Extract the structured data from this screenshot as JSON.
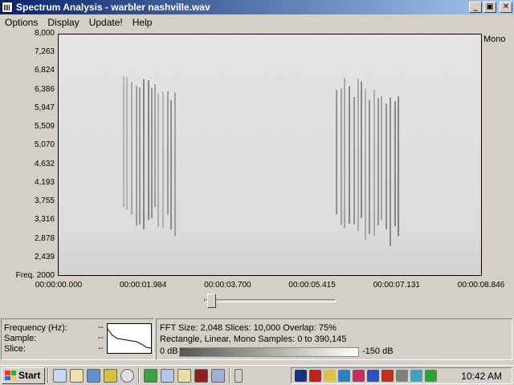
{
  "window": {
    "title": "Spectrum Analysis - warbler nashville.wav"
  },
  "title_buttons": {
    "minimize": "_",
    "maximize": "▣",
    "close": "✕"
  },
  "menu": [
    "Options",
    "Display",
    "Update!",
    "Help"
  ],
  "chart_data": {
    "type": "heatmap",
    "title": "",
    "channel_label": "Mono",
    "y_axis": {
      "label": "Freq.",
      "ticks": [
        "8,000",
        "7,263",
        "6,824",
        "6,386",
        "5,947",
        "5,509",
        "5,070",
        "4,632",
        "4,193",
        "3,755",
        "3,316",
        "2,878",
        "2,439",
        "2000"
      ],
      "ylim": [
        2000,
        8000
      ]
    },
    "x_axis": {
      "ticks": [
        "00:00:00.000",
        "00:00:01.984",
        "00:00:03.700",
        "00:00:05.415",
        "00:00:07.131",
        "00:00:08.846"
      ],
      "xlim_seconds": [
        0,
        8.846
      ]
    },
    "colorscale": {
      "min_label": "0 dB",
      "max_label": "-150 dB"
    }
  },
  "info": {
    "labels": [
      "Frequency (Hz):",
      "Sample:",
      "Slice:"
    ],
    "values": [
      "--",
      "--",
      "--"
    ]
  },
  "params": {
    "line1": "FFT Size: 2,048  Slices: 10,000  Overlap: 75%",
    "line2": "Rectangle, Linear, Mono  Samples: 0 to 390,145",
    "db_low": "0 dB",
    "db_high": "-150 dB"
  },
  "taskbar": {
    "start_label": "Start",
    "clock": "10:42 AM",
    "quick_icons": [
      "edit-icon",
      "hand-icon",
      "desktop-icon",
      "clock-icon",
      "media-icon"
    ],
    "app_icons": [
      "sound-icon",
      "doc-icon",
      "search-icon",
      "gauge-icon",
      "windows-icon"
    ],
    "tray_icons": [
      "network-icon",
      "adobe-icon",
      "monitor-icon",
      "globe-icon",
      "camera-icon",
      "chart-icon",
      "alert-icon",
      "volume-icon",
      "palette-icon",
      "world-icon"
    ]
  }
}
